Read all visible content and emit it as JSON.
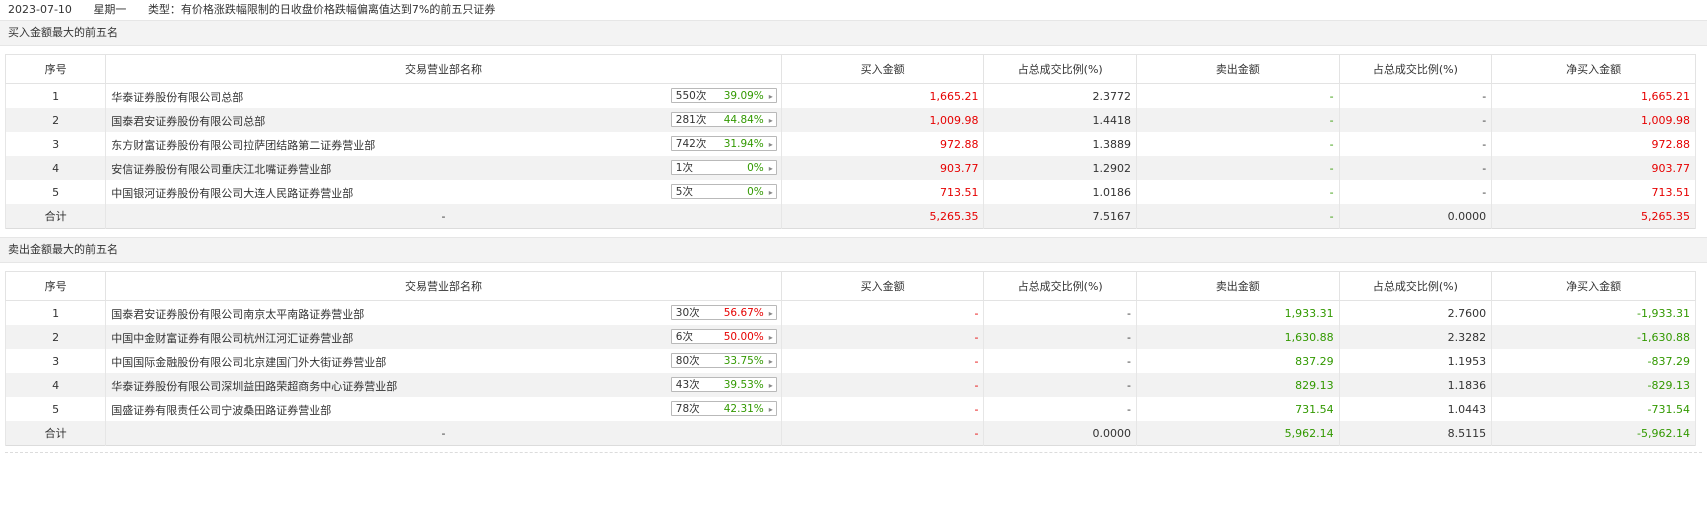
{
  "header": {
    "date": "2023-07-10",
    "weekday": "星期一",
    "type_text": "类型：有价格涨跌幅限制的日收盘价格跌幅偏离值达到7%的前五只证券"
  },
  "columns": [
    "序号",
    "交易营业部名称",
    "买入金额",
    "占总成交比例(%)",
    "卖出金额",
    "占总成交比例(%)",
    "净买入金额"
  ],
  "buy_section": {
    "title": "买入金额最大的前五名",
    "rows": [
      {
        "no": "1",
        "name": "华泰证券股份有限公司总部",
        "count": "550次",
        "pct": "39.09%",
        "pct_color": "green",
        "buy": "1,665.21",
        "buy_ratio": "2.3772",
        "sell": "-",
        "sell_ratio": "-",
        "net": "1,665.21"
      },
      {
        "no": "2",
        "name": "国泰君安证券股份有限公司总部",
        "count": "281次",
        "pct": "44.84%",
        "pct_color": "green",
        "buy": "1,009.98",
        "buy_ratio": "1.4418",
        "sell": "-",
        "sell_ratio": "-",
        "net": "1,009.98"
      },
      {
        "no": "3",
        "name": "东方财富证券股份有限公司拉萨团结路第二证券营业部",
        "count": "742次",
        "pct": "31.94%",
        "pct_color": "green",
        "buy": "972.88",
        "buy_ratio": "1.3889",
        "sell": "-",
        "sell_ratio": "-",
        "net": "972.88"
      },
      {
        "no": "4",
        "name": "安信证券股份有限公司重庆江北嘴证券营业部",
        "count": "1次",
        "pct": "0%",
        "pct_color": "green",
        "buy": "903.77",
        "buy_ratio": "1.2902",
        "sell": "-",
        "sell_ratio": "-",
        "net": "903.77"
      },
      {
        "no": "5",
        "name": "中国银河证券股份有限公司大连人民路证券营业部",
        "count": "5次",
        "pct": "0%",
        "pct_color": "green",
        "buy": "713.51",
        "buy_ratio": "1.0186",
        "sell": "-",
        "sell_ratio": "-",
        "net": "713.51"
      }
    ],
    "total": {
      "label": "合计",
      "name": "-",
      "buy": "5,265.35",
      "buy_ratio": "7.5167",
      "sell": "-",
      "sell_ratio": "0.0000",
      "net": "5,265.35"
    }
  },
  "sell_section": {
    "title": "卖出金额最大的前五名",
    "rows": [
      {
        "no": "1",
        "name": "国泰君安证券股份有限公司南京太平南路证券营业部",
        "count": "30次",
        "pct": "56.67%",
        "pct_color": "red",
        "buy": "-",
        "buy_ratio": "-",
        "sell": "1,933.31",
        "sell_ratio": "2.7600",
        "net": "-1,933.31"
      },
      {
        "no": "2",
        "name": "中国中金财富证券有限公司杭州江河汇证券营业部",
        "count": "6次",
        "pct": "50.00%",
        "pct_color": "red",
        "buy": "-",
        "buy_ratio": "-",
        "sell": "1,630.88",
        "sell_ratio": "2.3282",
        "net": "-1,630.88"
      },
      {
        "no": "3",
        "name": "中国国际金融股份有限公司北京建国门外大街证券营业部",
        "count": "80次",
        "pct": "33.75%",
        "pct_color": "green",
        "buy": "-",
        "buy_ratio": "-",
        "sell": "837.29",
        "sell_ratio": "1.1953",
        "net": "-837.29"
      },
      {
        "no": "4",
        "name": "华泰证券股份有限公司深圳益田路荣超商务中心证券营业部",
        "count": "43次",
        "pct": "39.53%",
        "pct_color": "green",
        "buy": "-",
        "buy_ratio": "-",
        "sell": "829.13",
        "sell_ratio": "1.1836",
        "net": "-829.13"
      },
      {
        "no": "5",
        "name": "国盛证券有限责任公司宁波桑田路证券营业部",
        "count": "78次",
        "pct": "42.31%",
        "pct_color": "green",
        "buy": "-",
        "buy_ratio": "-",
        "sell": "731.54",
        "sell_ratio": "1.0443",
        "net": "-731.54"
      }
    ],
    "total": {
      "label": "合计",
      "name": "-",
      "buy": "-",
      "buy_ratio": "0.0000",
      "sell": "5,962.14",
      "sell_ratio": "8.5115",
      "net": "-5,962.14"
    }
  },
  "colors": {
    "red": "#e60000",
    "green": "#329900"
  }
}
